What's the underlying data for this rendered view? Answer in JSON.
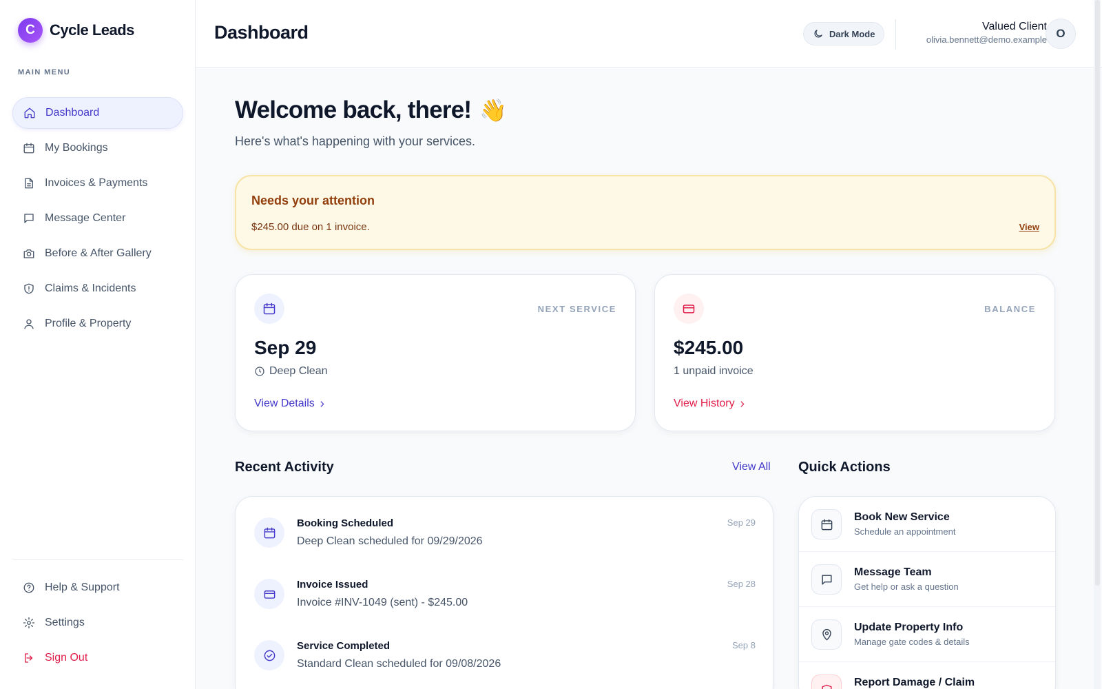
{
  "brand": {
    "logo_letter": "C",
    "name": "Cycle Leads"
  },
  "sidebar": {
    "menu_title": "MAIN MENU",
    "items": [
      {
        "label": "Dashboard",
        "icon": "home-icon",
        "active": true
      },
      {
        "label": "My Bookings",
        "icon": "calendar-icon"
      },
      {
        "label": "Invoices & Payments",
        "icon": "document-icon"
      },
      {
        "label": "Message Center",
        "icon": "message-icon"
      },
      {
        "label": "Before & After Gallery",
        "icon": "camera-icon"
      },
      {
        "label": "Claims & Incidents",
        "icon": "shield-icon"
      },
      {
        "label": "Profile & Property",
        "icon": "user-icon"
      }
    ],
    "bottom": {
      "help": "Help & Support",
      "settings": "Settings",
      "signout": "Sign Out"
    }
  },
  "header": {
    "title": "Dashboard",
    "dark_mode_label": "Dark Mode",
    "user_name": "Valued Client",
    "user_email": "olivia.bennett@demo.example",
    "avatar_letter": "O"
  },
  "welcome": {
    "title": "Welcome back, there!",
    "emoji": "👋",
    "subtitle": "Here's what's happening with your services."
  },
  "attention": {
    "title": "Needs your attention",
    "text": "$245.00 due on 1 invoice.",
    "link": "View"
  },
  "next_service": {
    "label": "NEXT SERVICE",
    "value": "Sep 29",
    "sub": "Deep Clean",
    "link": "View Details"
  },
  "balance": {
    "label": "BALANCE",
    "value": "$245.00",
    "sub": "1 unpaid invoice",
    "link": "View History"
  },
  "recent_activity": {
    "title": "Recent Activity",
    "view_all": "View All",
    "items": [
      {
        "title": "Booking Scheduled",
        "desc": "Deep Clean scheduled for 09/29/2026",
        "date": "Sep 29",
        "icon": "calendar-icon"
      },
      {
        "title": "Invoice Issued",
        "desc": "Invoice #INV-1049 (sent) - $245.00",
        "date": "Sep 28",
        "icon": "credit-card-icon"
      },
      {
        "title": "Service Completed",
        "desc": "Standard Clean scheduled for 09/08/2026",
        "date": "Sep 8",
        "icon": "check-circle-icon"
      }
    ]
  },
  "quick_actions": {
    "title": "Quick Actions",
    "items": [
      {
        "title": "Book New Service",
        "desc": "Schedule an appointment",
        "icon": "calendar-icon"
      },
      {
        "title": "Message Team",
        "desc": "Get help or ask a question",
        "icon": "message-icon"
      },
      {
        "title": "Update Property Info",
        "desc": "Manage gate codes & details",
        "icon": "map-pin-icon"
      },
      {
        "title": "Report Damage / Claim",
        "desc": "",
        "icon": "shield-alert-icon"
      }
    ]
  },
  "colors": {
    "accent": "#4338ca",
    "danger": "#e11d48",
    "warning_bg": "#fef9e7"
  }
}
